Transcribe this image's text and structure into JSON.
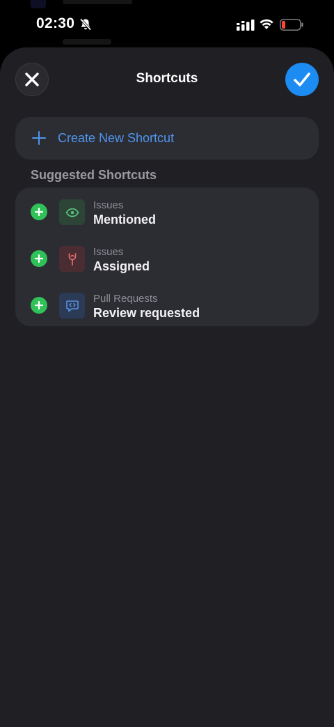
{
  "status_bar": {
    "time": "02:30",
    "icons": [
      "bell-slash-icon",
      "cellular-signal-icon",
      "wifi-icon",
      "battery-low-icon"
    ],
    "battery_color": "#ff453a"
  },
  "sheet": {
    "title": "Shortcuts",
    "close_icon": "close-icon",
    "confirm_icon": "checkmark-icon",
    "accent_color": "#1c8cf2"
  },
  "create": {
    "label": "Create New Shortcut",
    "icon": "plus-icon",
    "color": "#4f96ee"
  },
  "suggested": {
    "heading": "Suggested Shortcuts",
    "items": [
      {
        "category": "Issues",
        "title": "Mentioned",
        "icon": "eye-icon",
        "color": "#5cbf7e"
      },
      {
        "category": "Issues",
        "title": "Assigned",
        "icon": "assignee-icon",
        "color": "#e06d6d"
      },
      {
        "category": "Pull Requests",
        "title": "Review requested",
        "icon": "code-review-icon",
        "color": "#5a8fe0"
      }
    ]
  }
}
